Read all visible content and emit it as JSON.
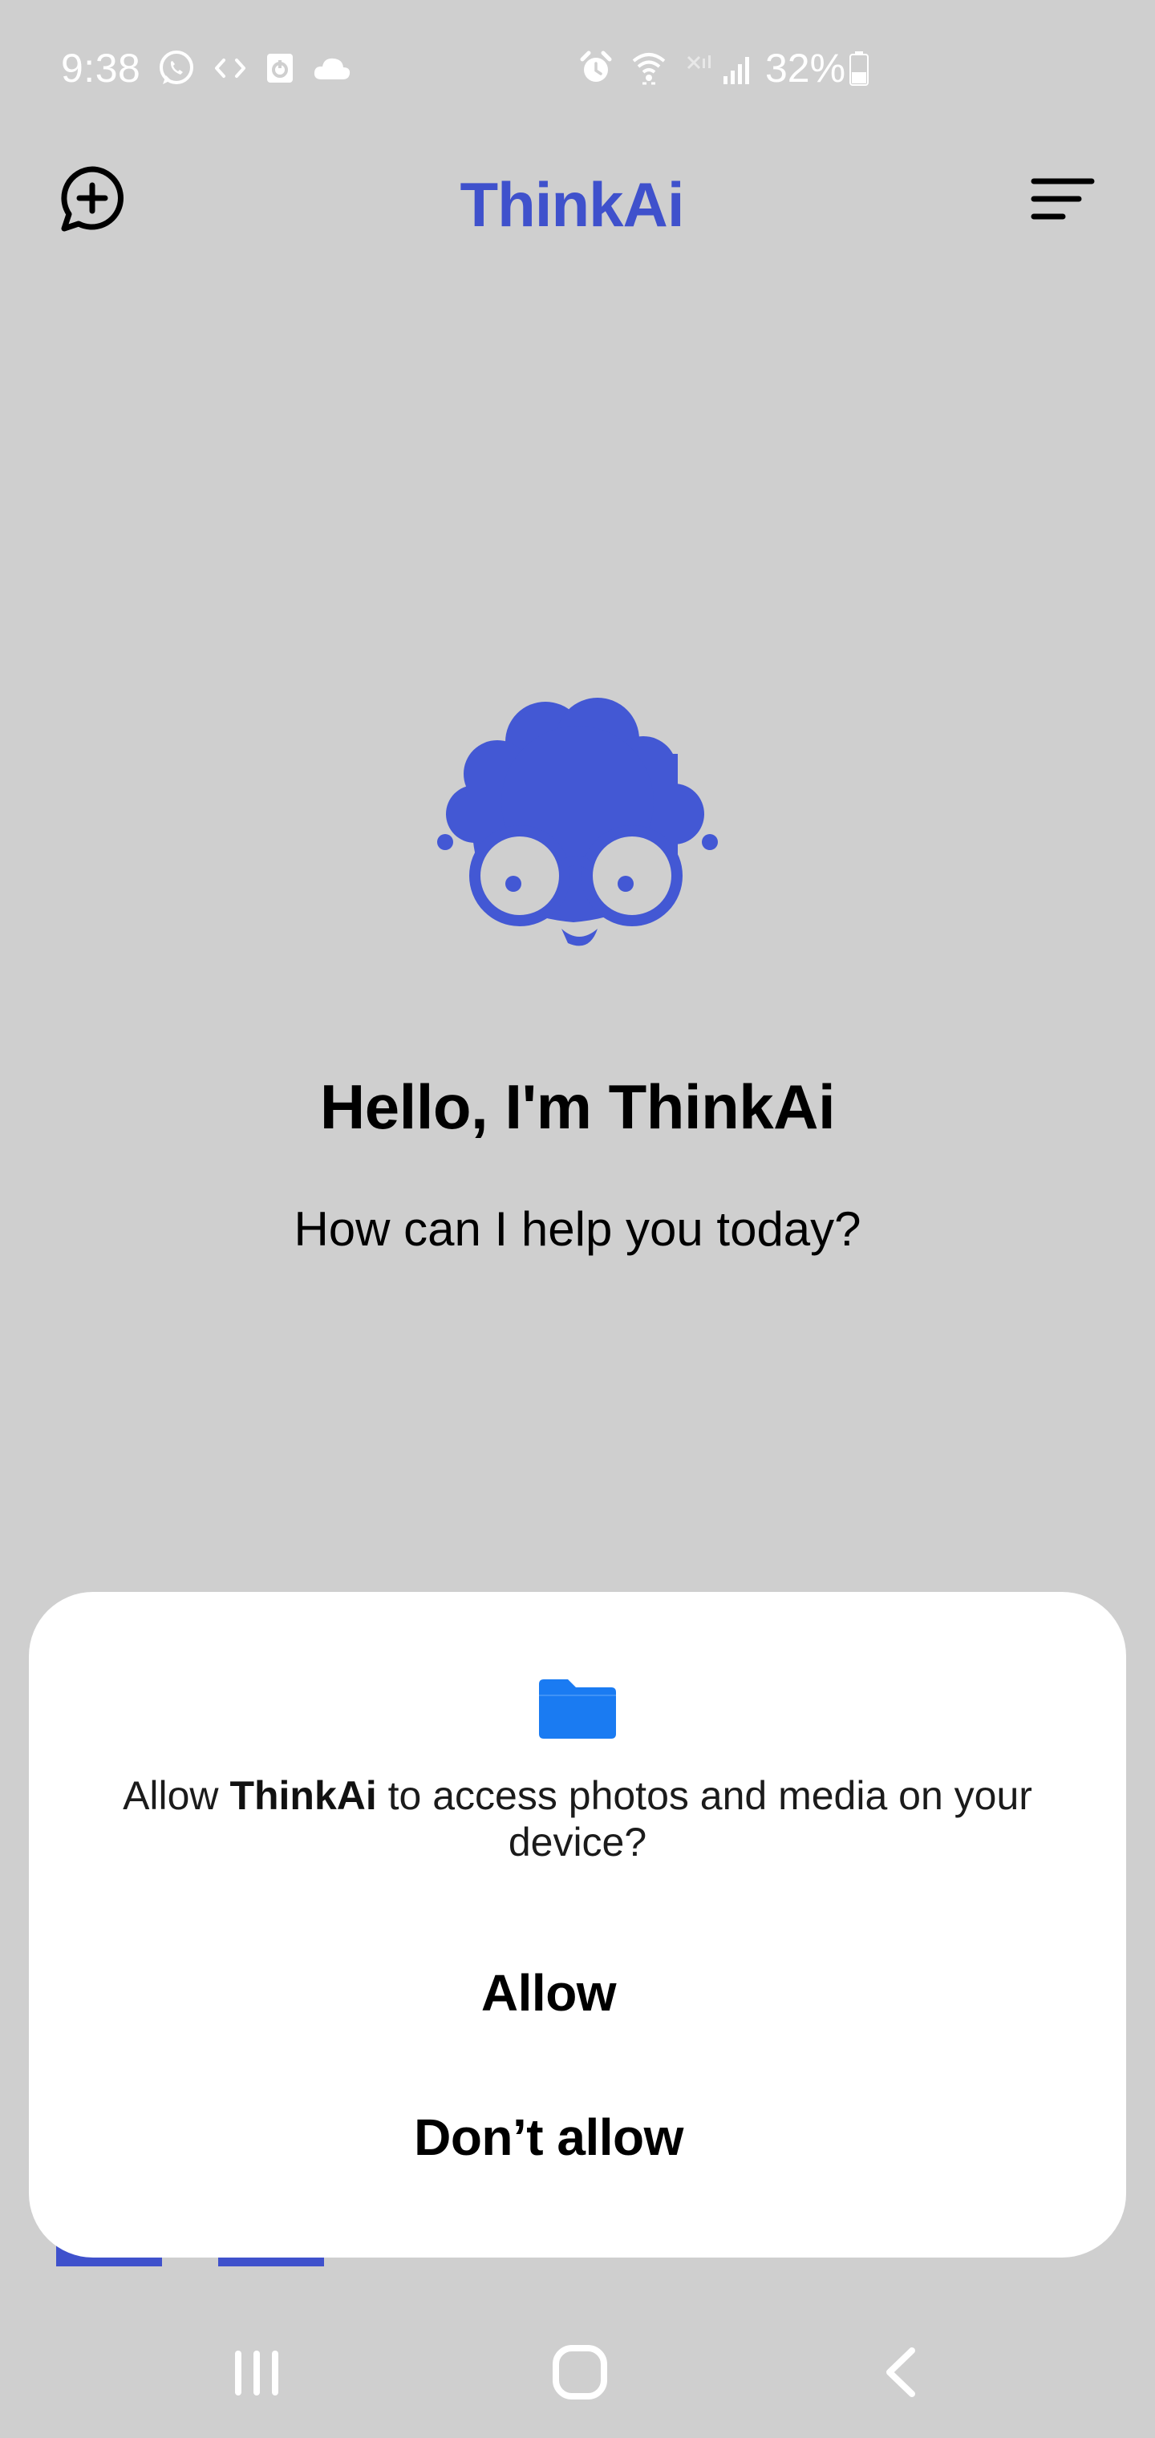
{
  "status_bar": {
    "time": "9:38",
    "battery": "32%",
    "left_icons": [
      "whatsapp-icon",
      "code-icon",
      "app-notification-icon",
      "cloud-icon"
    ],
    "right_icons": [
      "alarm-icon",
      "wifi-icon",
      "mobile-data-off-icon",
      "signal-icon",
      "battery-icon"
    ]
  },
  "header": {
    "title": "ThinkAi",
    "new_chat_icon": "new-chat-icon",
    "menu_icon": "menu-icon"
  },
  "main": {
    "mascot_icon": "thinkai-mascot-logo",
    "greeting_title": "Hello, I'm ThinkAi",
    "greeting_subtitle": "How can I help you today?"
  },
  "dialog": {
    "icon": "folder-icon",
    "message_prefix": "Allow ",
    "app_name": "ThinkAi",
    "message_suffix": " to access photos and media on your device?",
    "allow_label": "Allow",
    "deny_label": "Don’t allow"
  },
  "nav_bar": {
    "recents_icon": "recents-icon",
    "home_icon": "home-icon",
    "back_icon": "back-icon"
  },
  "colors": {
    "brand": "#3f51cc",
    "background": "#cfcfcf",
    "dialog_background": "#ffffff",
    "folder": "#1a7bf2"
  }
}
